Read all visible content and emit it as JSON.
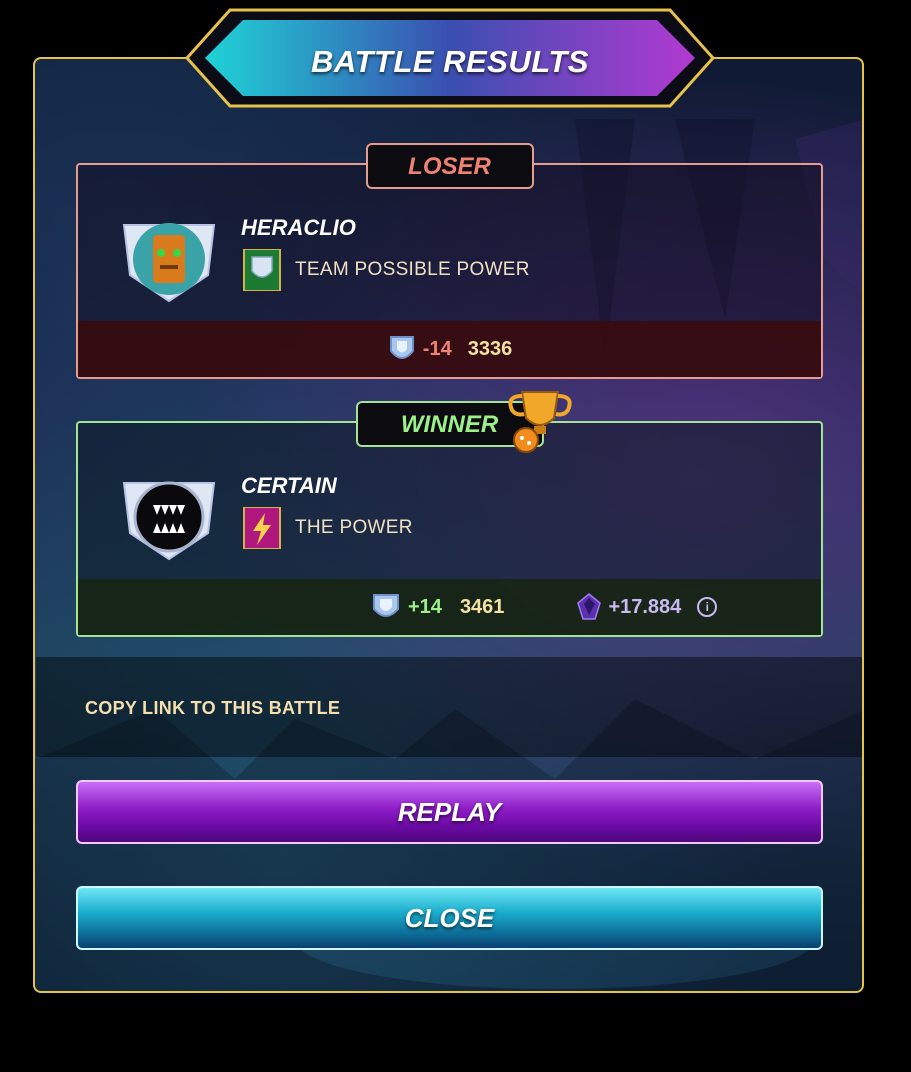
{
  "dialog": {
    "title": "BATTLE RESULTS"
  },
  "loser": {
    "tag": "LOSER",
    "name": "HERACLIO",
    "guild": "TEAM POSSIBLE POWER",
    "rating_delta": "-14",
    "rating": "3336"
  },
  "winner": {
    "tag": "WINNER",
    "name": "CERTAIN",
    "guild": "THE POWER",
    "rating_delta": "+14",
    "rating": "3461",
    "reward": "+17.884"
  },
  "actions": {
    "copy_link": "COPY LINK TO THIS BATTLE",
    "replay": "REPLAY",
    "close": "CLOSE"
  },
  "colors": {
    "frame_gold": "#e7c24a",
    "loser_accent": "#f08274",
    "winner_accent": "#9cf08a",
    "replay_purple": "#8d1cc7",
    "close_cyan": "#1aaecd"
  },
  "icons": {
    "rating": "league-shield-icon",
    "reward": "dark-energy-crystal-icon",
    "info": "info-icon",
    "trophy": "trophy-icon"
  }
}
